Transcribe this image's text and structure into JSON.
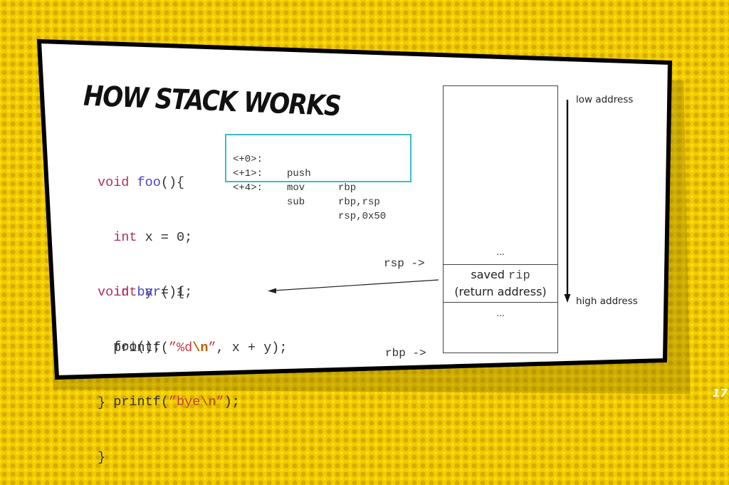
{
  "slide": {
    "title": "How Stack Works",
    "page_number": "17"
  },
  "code": {
    "foo": {
      "line1": {
        "kw": "void",
        "fn": "foo",
        "rest": "(){"
      },
      "line2": {
        "kw": "int",
        "rest": " x = 0;"
      },
      "line3": {
        "kw": "int",
        "rest": " y = 1;"
      },
      "line4": {
        "pre": "printf(",
        "str": "”%d",
        "esc": "\\n",
        "str_end": "”",
        "post": ", x + y);"
      },
      "line5": "}"
    },
    "bar": {
      "line1": {
        "kw": "void",
        "fn": "bar",
        "rest": "(){"
      },
      "line2": "foo();",
      "line3": {
        "pre": "printf(",
        "str": "”bye",
        "esc": "\\n",
        "str_end": "”",
        "post": ");"
      },
      "line4": "}"
    }
  },
  "disassembly": [
    {
      "offset": "<+0>:",
      "op": "push",
      "args": "rbp"
    },
    {
      "offset": "<+1>:",
      "op": "mov",
      "args": "rbp,rsp"
    },
    {
      "offset": "<+4>:",
      "op": "sub",
      "args": "rsp,0x50"
    }
  ],
  "stack": {
    "cells": {
      "above": "...",
      "saved_label": "saved",
      "saved_reg": "rip",
      "saved_desc": "(return address)",
      "below": "..."
    },
    "pointers": {
      "rsp": "rsp ->",
      "rbp": "rbp ->"
    },
    "direction": {
      "top": "low address",
      "bottom": "high address"
    }
  },
  "colors": {
    "background": "#f2cc00",
    "asm_border": "#3bbcc6",
    "keyword": "#b0305a",
    "function": "#4a3fcc",
    "string": "#c23c4f",
    "escape": "#b56300"
  }
}
